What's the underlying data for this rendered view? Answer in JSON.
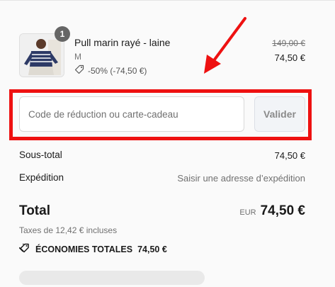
{
  "product": {
    "quantity": "1",
    "title": "Pull marin rayé - laine",
    "variant": "M",
    "discount_label": "-50% (-74,50 €)",
    "original_price": "149,00 €",
    "price": "74,50 €",
    "icons": {
      "discount": "tag-icon"
    }
  },
  "discount": {
    "placeholder": "Code de réduction ou carte-cadeau",
    "value": "",
    "apply_label": "Valider"
  },
  "totals": {
    "subtotal_label": "Sous-total",
    "subtotal_value": "74,50 €",
    "shipping_label": "Expédition",
    "shipping_value": "Saisir une adresse d’expédition",
    "total_label": "Total",
    "currency": "EUR",
    "total_value": "74,50 €",
    "tax_note": "Taxes de 12,42 € incluses",
    "savings_label": "ÉCONOMIES TOTALES",
    "savings_value": "74,50 €"
  },
  "colors": {
    "highlight": "#ee1111",
    "text": "#1a1a1a",
    "muted": "#707070"
  }
}
